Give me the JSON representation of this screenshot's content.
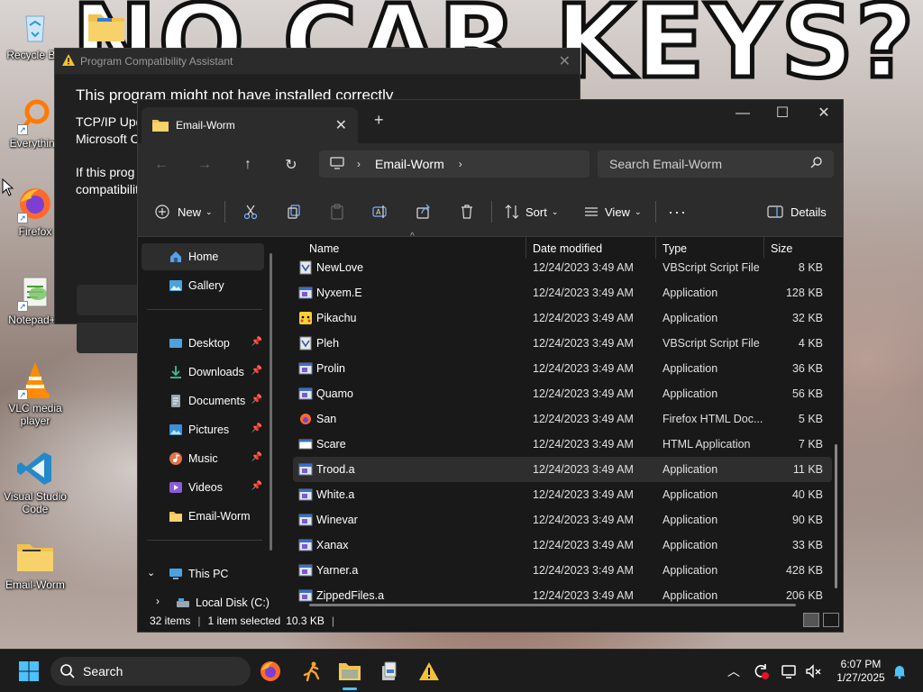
{
  "wallpaper": {
    "meme_text": "NO CAR KEYS?"
  },
  "desktop": {
    "icons": [
      {
        "label": "Recycle Bin",
        "icon": "recycle-bin-icon"
      },
      {
        "label": "Everything",
        "icon": "everything-icon"
      },
      {
        "label": "Firefox",
        "icon": "firefox-icon"
      },
      {
        "label": "Notepad++",
        "icon": "notepad-plus-plus-icon"
      },
      {
        "label": "VLC media player",
        "icon": "vlc-icon"
      },
      {
        "label": "Visual Studio Code",
        "icon": "vscode-icon"
      },
      {
        "label": "Email-Worm",
        "icon": "folder-icon"
      }
    ]
  },
  "pca": {
    "title": "Program Compatibility Assistant",
    "heading": "This program might not have installed correctly",
    "line1": "TCP/IP Upd",
    "line2": "Microsoft C",
    "line3": "If this prog",
    "line4": "compatibilit"
  },
  "explorer": {
    "tab_title": "Email-Worm",
    "breadcrumb": "Email-Worm",
    "search_placeholder": "Search Email-Worm",
    "toolbar": {
      "new": "New",
      "sort": "Sort",
      "view": "View",
      "details": "Details"
    },
    "sidebar": {
      "home": "Home",
      "gallery": "Gallery",
      "desktop": "Desktop",
      "downloads": "Downloads",
      "documents": "Documents",
      "pictures": "Pictures",
      "music": "Music",
      "videos": "Videos",
      "email_worm": "Email-Worm",
      "this_pc": "This PC",
      "local_disk": "Local Disk (C:)"
    },
    "columns": {
      "name": "Name",
      "date": "Date modified",
      "type": "Type",
      "size": "Size"
    },
    "files": [
      {
        "name": "NewLove",
        "date": "12/24/2023 3:49 AM",
        "type": "VBScript Script File",
        "size": "8 KB",
        "icon": "vbs-icon"
      },
      {
        "name": "Nyxem.E",
        "date": "12/24/2023 3:49 AM",
        "type": "Application",
        "size": "128 KB",
        "icon": "app-icon"
      },
      {
        "name": "Pikachu",
        "date": "12/24/2023 3:49 AM",
        "type": "Application",
        "size": "32 KB",
        "icon": "pikachu-icon"
      },
      {
        "name": "Pleh",
        "date": "12/24/2023 3:49 AM",
        "type": "VBScript Script File",
        "size": "4 KB",
        "icon": "vbs-icon"
      },
      {
        "name": "Prolin",
        "date": "12/24/2023 3:49 AM",
        "type": "Application",
        "size": "36 KB",
        "icon": "app-icon"
      },
      {
        "name": "Quamo",
        "date": "12/24/2023 3:49 AM",
        "type": "Application",
        "size": "56 KB",
        "icon": "app-icon"
      },
      {
        "name": "San",
        "date": "12/24/2023 3:49 AM",
        "type": "Firefox HTML Doc...",
        "size": "5 KB",
        "icon": "firefox-doc-icon"
      },
      {
        "name": "Scare",
        "date": "12/24/2023 3:49 AM",
        "type": "HTML Application",
        "size": "7 KB",
        "icon": "hta-icon"
      },
      {
        "name": "Trood.a",
        "date": "12/24/2023 3:49 AM",
        "type": "Application",
        "size": "11 KB",
        "icon": "app-icon",
        "selected": true
      },
      {
        "name": "White.a",
        "date": "12/24/2023 3:49 AM",
        "type": "Application",
        "size": "40 KB",
        "icon": "app-icon"
      },
      {
        "name": "Winevar",
        "date": "12/24/2023 3:49 AM",
        "type": "Application",
        "size": "90 KB",
        "icon": "app-icon"
      },
      {
        "name": "Xanax",
        "date": "12/24/2023 3:49 AM",
        "type": "Application",
        "size": "33 KB",
        "icon": "app-icon"
      },
      {
        "name": "Yarner.a",
        "date": "12/24/2023 3:49 AM",
        "type": "Application",
        "size": "428 KB",
        "icon": "app-icon"
      },
      {
        "name": "ZippedFiles.a",
        "date": "12/24/2023 3:49 AM",
        "type": "Application",
        "size": "206 KB",
        "icon": "app-icon"
      }
    ],
    "status": {
      "count": "32 items",
      "selected": "1 item selected",
      "size": "10.3 KB"
    }
  },
  "taskbar": {
    "search": "Search",
    "time": "6:07 PM",
    "date": "1/27/2025"
  }
}
